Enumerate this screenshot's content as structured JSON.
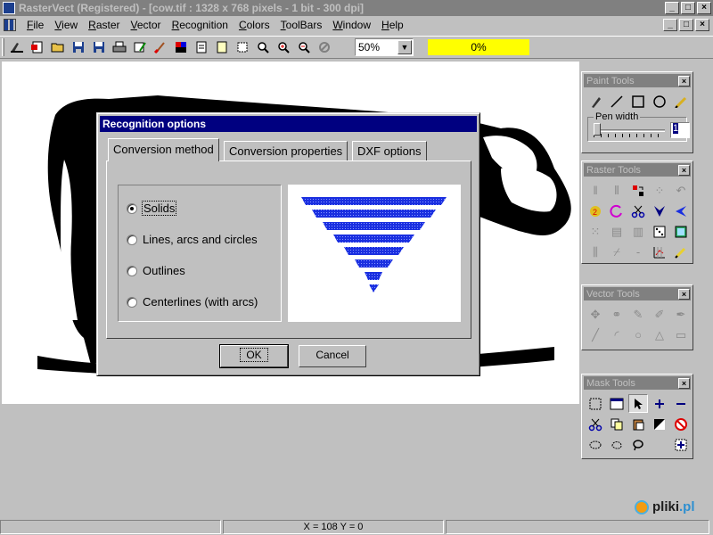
{
  "window": {
    "title": "RasterVect (Registered) - [cow.tif : 1328 x 768 pixels - 1 bit - 300 dpi]",
    "buttons": [
      "_",
      "□",
      "×"
    ]
  },
  "menu": {
    "items": [
      "File",
      "View",
      "Raster",
      "Vector",
      "Recognition",
      "Colors",
      "ToolBars",
      "Window",
      "Help"
    ]
  },
  "toolbar": {
    "zoom_value": "50%",
    "progress": "0%",
    "progress_color": "#ffff00"
  },
  "palettes": {
    "paint": {
      "title": "Paint Tools",
      "pen_width_label": "Pen width",
      "pen_width_value": "1"
    },
    "raster": {
      "title": "Raster Tools"
    },
    "vector": {
      "title": "Vector Tools"
    },
    "mask": {
      "title": "Mask Tools"
    }
  },
  "dialog": {
    "title": "Recognition options",
    "tabs": [
      "Conversion method",
      "Conversion properties",
      "DXF options"
    ],
    "active_tab": "Conversion method",
    "options": [
      "Solids",
      "Lines, arcs and circles",
      "Outlines",
      "Centerlines (with arcs)"
    ],
    "selected_option": "Solids",
    "ok_label": "OK",
    "cancel_label": "Cancel"
  },
  "statusbar": {
    "coords": "X = 108   Y = 0"
  },
  "watermark": {
    "text_main": "pliki",
    "text_suffix": ".pl"
  },
  "colors": {
    "title_active": "#000080",
    "title_inactive": "#808080",
    "preview_blue": "#1a2fe0"
  }
}
